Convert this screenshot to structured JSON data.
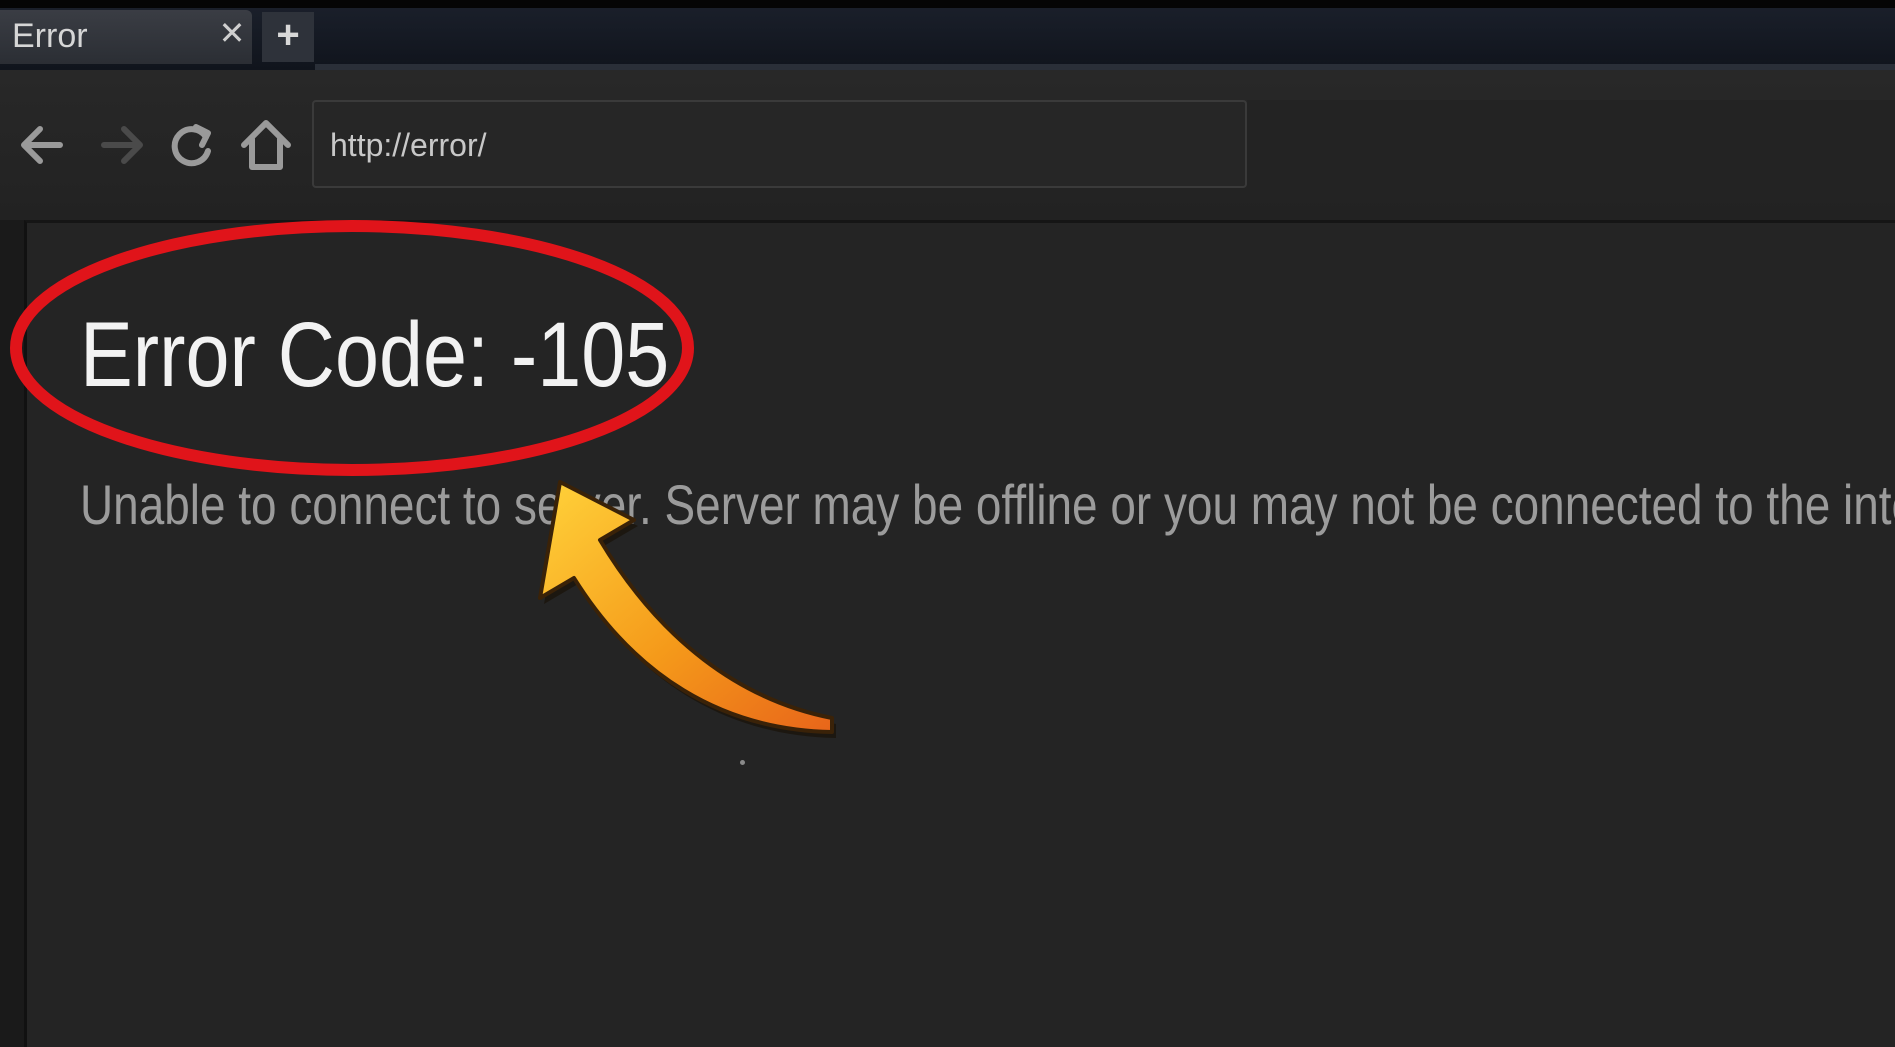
{
  "tab": {
    "title": "Error",
    "close_label": "✕",
    "new_tab_label": "+"
  },
  "toolbar": {
    "back_icon": "arrow-left-icon",
    "forward_icon": "arrow-right-icon",
    "reload_icon": "reload-icon",
    "home_icon": "home-icon",
    "address_value": "http://error/"
  },
  "page": {
    "title": "Error Code: -105",
    "message": "Unable to connect to server. Server may be offline or you may not be connected to the internet."
  },
  "colors": {
    "annotation_circle": "#e0141a",
    "annotation_arrow": "#f59a1a"
  }
}
